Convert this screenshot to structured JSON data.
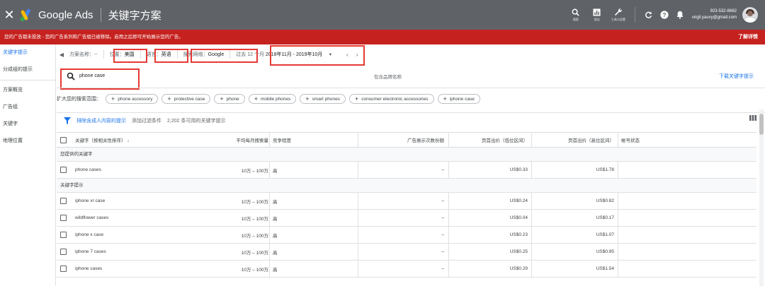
{
  "topbar": {
    "brand": "Google Ads",
    "page_title": "关键字方案",
    "tools": [
      {
        "label": "搜索",
        "icon": "search-icon"
      },
      {
        "label": "报告",
        "icon": "reports-icon"
      },
      {
        "label": "工具与设置",
        "icon": "wrench-icon"
      }
    ],
    "phone": "923-532-8662",
    "email": "virgil.yauvy@gmail.com"
  },
  "alert": {
    "text": "您的广告都未投放 - 您的广告系列和广告组已被移除。启用之后即可开始展示您的广告。",
    "link": "了解详情"
  },
  "sidebar": {
    "items": [
      {
        "label": "关键字提示",
        "active": true
      },
      {
        "label": "分成组的提示",
        "active": false
      },
      {
        "label": "方案概览",
        "active": false
      },
      {
        "label": "广告组",
        "active": false
      },
      {
        "label": "关键字",
        "active": false
      },
      {
        "label": "地理位置",
        "active": false
      }
    ]
  },
  "settings": {
    "plan_label": "方案名称：",
    "plan_value": "--",
    "location_label": "位置：",
    "location_value": "美国",
    "language_label": "语言：",
    "language_value": "英语",
    "network_label": "搜索网络：",
    "network_value": "Google",
    "period_label": "过去 12 个月",
    "period_value": "2018年11月 - 2019年10月"
  },
  "search": {
    "query": "phone case",
    "brand_toggle": "包含品牌名称",
    "download": "下载关键字提示"
  },
  "broaden": {
    "label": "扩大您的搜索范围：",
    "pills": [
      "phone accessory",
      "protective case",
      "phone",
      "mobile phones",
      "smart phones",
      "consumer electronic accessories",
      "iphone case"
    ]
  },
  "filterbar": {
    "exclude": "排除含成人内容的提示",
    "add_filter": "添加过滤条件",
    "count": "2,202 条可用的关键字提示"
  },
  "table": {
    "headers": {
      "keyword": "关键字（按相关性排序）",
      "volume": "平均每月搜索量",
      "competition": "竞争程度",
      "share": "广告展示次数份额",
      "bid_low": "页首出价（低位区间）",
      "bid_high": "页首出价（高位区间）",
      "status": "帐号状态"
    },
    "section_provided": "您提供的关键字",
    "provided_rows": [
      {
        "keyword": "phone cases",
        "volume": "10万 – 100万",
        "competition": "高",
        "share": "–",
        "bid_low": "US$0.33",
        "bid_high": "US$1.78"
      }
    ],
    "section_ideas": "关键字提示",
    "idea_rows": [
      {
        "keyword": "iphone xr case",
        "volume": "10万 – 100万",
        "competition": "高",
        "share": "–",
        "bid_low": "US$0.24",
        "bid_high": "US$0.82"
      },
      {
        "keyword": "wildflower cases",
        "volume": "10万 – 100万",
        "competition": "高",
        "share": "–",
        "bid_low": "US$0.04",
        "bid_high": "US$0.17"
      },
      {
        "keyword": "iphone x case",
        "volume": "10万 – 100万",
        "competition": "高",
        "share": "–",
        "bid_low": "US$0.23",
        "bid_high": "US$1.07"
      },
      {
        "keyword": "iphone 7 cases",
        "volume": "10万 – 100万",
        "competition": "高",
        "share": "–",
        "bid_low": "US$0.25",
        "bid_high": "US$0.95"
      },
      {
        "keyword": "iphone cases",
        "volume": "10万 – 100万",
        "competition": "高",
        "share": "–",
        "bid_low": "US$0.29",
        "bid_high": "US$1.54"
      }
    ]
  },
  "colors": {
    "topbar": "#5f6368",
    "alert": "#c5221f",
    "accent": "#1a73e8",
    "highlight_box": "#e53935"
  }
}
